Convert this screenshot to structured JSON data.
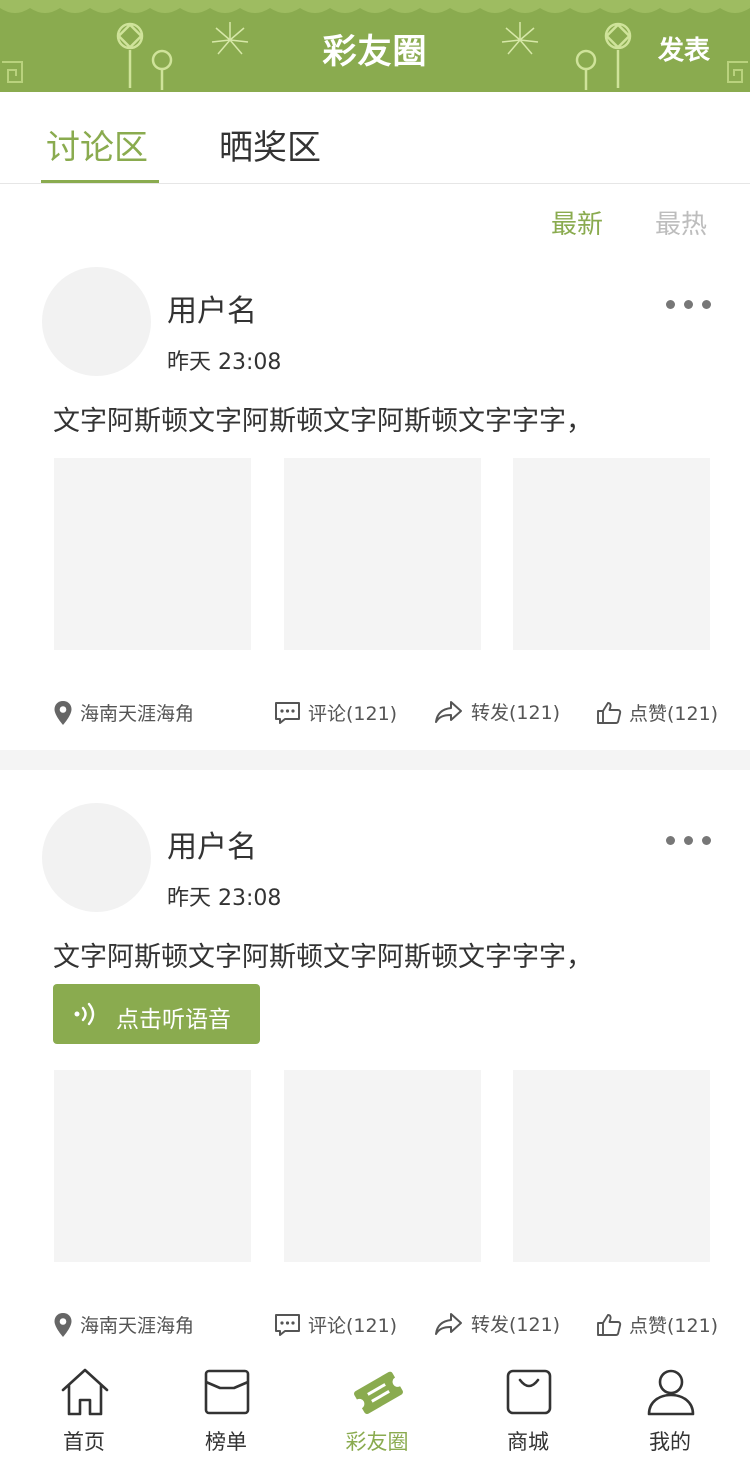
{
  "header": {
    "title": "彩友圈",
    "publish_label": "发表",
    "accent_color": "#8aab4f"
  },
  "tabs": [
    {
      "label": "讨论区",
      "active": true
    },
    {
      "label": "晒奖区",
      "active": false
    }
  ],
  "sort": {
    "newest": "最新",
    "hottest": "最热",
    "selected": "最新"
  },
  "posts": [
    {
      "username": "用户名",
      "time": "昨天 23:08",
      "text": "文字阿斯顿文字阿斯顿文字阿斯顿文字字字，",
      "location": "海南天涯海角",
      "comment": "评论(121)",
      "forward": "转发(121)",
      "like": "点赞(121)"
    },
    {
      "username": "用户名",
      "time": "昨天 23:08",
      "text": "文字阿斯顿文字阿斯顿文字阿斯顿文字字字，",
      "voice_label": "点击听语音",
      "location": "海南天涯海角",
      "comment": "评论(121)",
      "forward": "转发(121)",
      "like": "点赞(121)"
    }
  ],
  "bottom_nav": [
    {
      "label": "首页",
      "icon": "home-icon",
      "active": false
    },
    {
      "label": "榜单",
      "icon": "bookmark-icon",
      "active": false
    },
    {
      "label": "彩友圈",
      "icon": "ticket-icon",
      "active": true
    },
    {
      "label": "商城",
      "icon": "shopping-bag-icon",
      "active": false
    },
    {
      "label": "我的",
      "icon": "user-icon",
      "active": false
    }
  ]
}
